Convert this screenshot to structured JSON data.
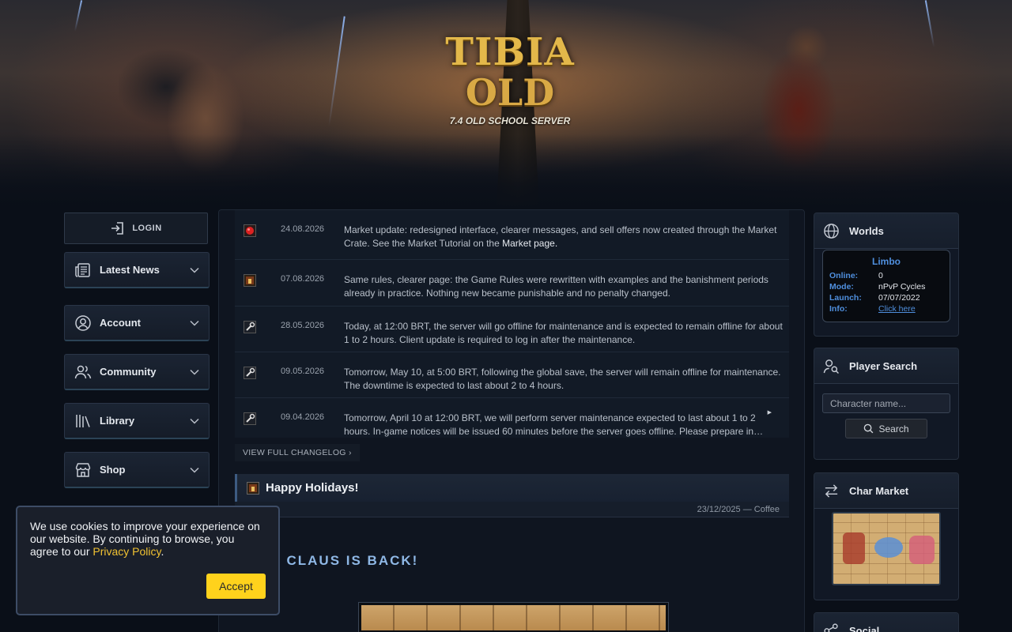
{
  "header": {
    "logo_line1": "TIBIA",
    "logo_line2": "OLD",
    "logo_tagline": "7.4 OLD SCHOOL SERVER"
  },
  "sidebar": {
    "login_label": "LOGIN",
    "items": [
      {
        "label": "Latest News",
        "icon": "newspaper-icon"
      },
      {
        "label": "Account",
        "icon": "user-circle-icon"
      },
      {
        "label": "Community",
        "icon": "users-icon"
      },
      {
        "label": "Library",
        "icon": "library-icon"
      },
      {
        "label": "Shop",
        "icon": "store-icon"
      }
    ]
  },
  "changelog": {
    "rows": [
      {
        "icon": "red-orb-icon",
        "date": "24.08.2026",
        "text": "Market update: redesigned interface, clearer messages, and sell offers now created through the Market Crate. See the Market Tutorial on the ",
        "link": "Market page."
      },
      {
        "icon": "rules-book-icon",
        "date": "07.08.2026",
        "text": "Same rules, clearer page: the Game Rules were rewritten with examples and the banishment periods already in practice. Nothing new became punishable and no penalty changed."
      },
      {
        "icon": "wrench-icon",
        "date": "28.05.2026",
        "text": "Today, at 12:00 BRT, the server will go offline for maintenance and is expected to remain offline for about 1 to 2 hours. Client update is required to log in after the maintenance."
      },
      {
        "icon": "wrench-icon",
        "date": "09.05.2026",
        "text": "Tomorrow, May 10, at 5:00 BRT, following the global save, the server will remain offline for maintenance. The downtime is expected to last about 2 to 4 hours."
      },
      {
        "icon": "wrench-icon",
        "date": "09.04.2026",
        "text": "Tomorrow, April 10 at 12:00 BRT, we will perform server maintenance expected to last about 1 to 2 hours. In-game notices will be issued 60 minutes before the server goes offline. Please prepare in…"
      }
    ],
    "view_full": "VIEW FULL CHANGELOG ›"
  },
  "news": {
    "title": "Happy Holidays!",
    "meta": "23/12/2025 — Coffee",
    "heading": "TA CLAUS IS BACK!"
  },
  "worlds": {
    "title": "Worlds",
    "name": "Limbo",
    "rows": [
      {
        "key": "Online:",
        "value": "0"
      },
      {
        "key": "Mode:",
        "value": "nPvP Cycles"
      },
      {
        "key": "Launch:",
        "value": "07/07/2022"
      },
      {
        "key": "Info:",
        "value": "Click here"
      }
    ]
  },
  "player_search": {
    "title": "Player Search",
    "placeholder": "Character name...",
    "button": "Search"
  },
  "char_market": {
    "title": "Char Market"
  },
  "social": {
    "title": "Social"
  },
  "cookie": {
    "text": "We use cookies to improve your experience on our website. By continuing to browse, you agree to our ",
    "link": "Privacy Policy",
    "after": ".",
    "accept": "Accept"
  },
  "colors": {
    "accent_blue": "#4f8fde",
    "accept_yellow": "#ffd21c",
    "heading_blue": "#8fb8e6"
  }
}
